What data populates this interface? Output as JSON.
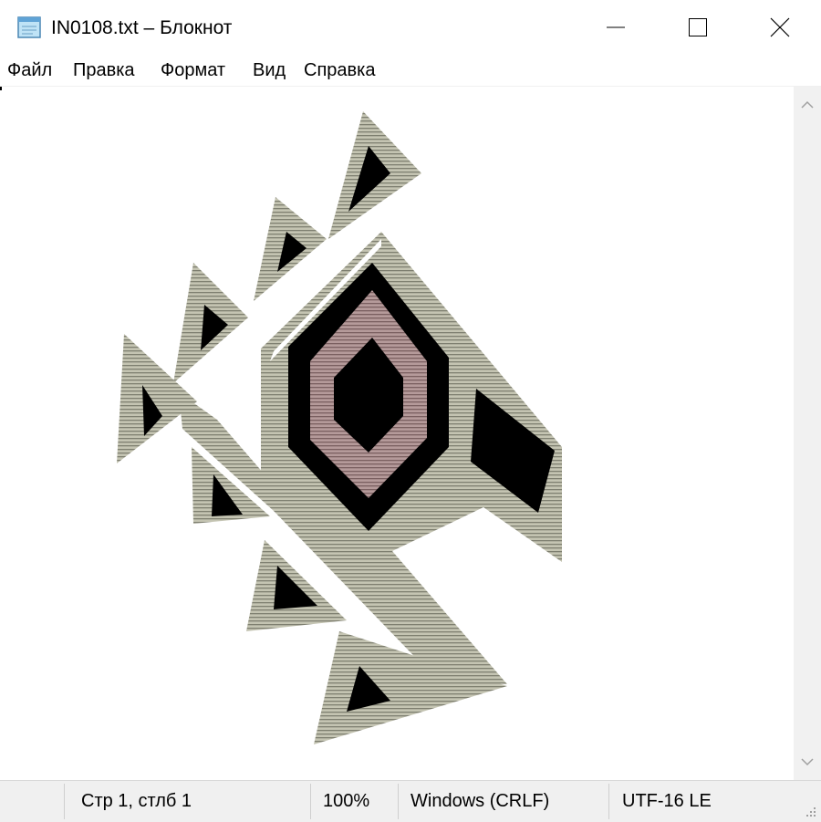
{
  "window": {
    "title": "IN0108.txt – Блокнот",
    "minimize_glyph": "—",
    "close_glyph": "✕"
  },
  "menu": [
    "Файл",
    "Правка",
    "Формат",
    "Вид",
    "Справка"
  ],
  "statusbar": {
    "position": "Стр 1, стлб 1",
    "zoom": "100%",
    "line_ending": "Windows (CRLF)",
    "encoding": "UTF-16 LE"
  },
  "colors": {
    "ornament_beige": "#b8b8a6",
    "ornament_black": "#000000",
    "ornament_mauve": "#a88a8a",
    "window_bg": "#ffffff",
    "status_bg": "#f0f0f0"
  },
  "icons": [
    "notepad-icon",
    "minimize-icon",
    "maximize-icon",
    "close-icon",
    "scroll-up-icon",
    "scroll-down-icon",
    "resize-grip-icon"
  ]
}
